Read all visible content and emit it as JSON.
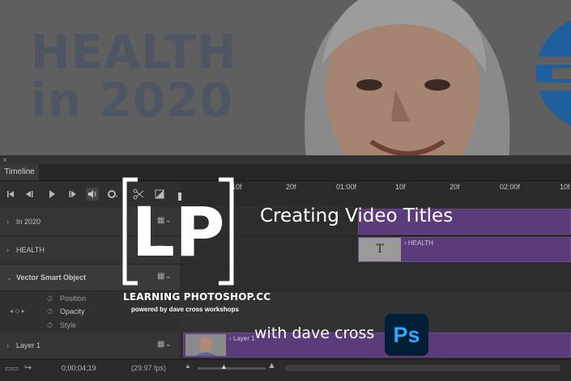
{
  "preview": {
    "title_lines": [
      "HEALTH",
      "in 2020"
    ]
  },
  "panel": {
    "close_glyph": "×",
    "tab_label": "Timeline"
  },
  "toolbar": {
    "icons": [
      "go-to-first-frame-icon",
      "previous-frame-icon",
      "play-icon",
      "next-frame-icon",
      "audio-icon",
      "settings-icon",
      "split-at-playhead-icon",
      "transition-icon"
    ]
  },
  "ruler": {
    "ticks": [
      "10f",
      "20f",
      "01:00f",
      "10f",
      "20f",
      "02:00f",
      "10f"
    ]
  },
  "tracks": [
    {
      "label": "In 2020"
    },
    {
      "label": "HEALTH",
      "clip_label": "HEALTH",
      "clip_thumb": "T"
    },
    {
      "label": "Vector Smart Object",
      "properties": [
        "Position",
        "Opacity",
        "Style"
      ]
    },
    {
      "label": "Layer 1",
      "clip_label": "Layer 1"
    }
  ],
  "status": {
    "timecode": "0;00;04;19",
    "fps": "(29.97 fps)"
  },
  "branding": {
    "logo_letters": "LP",
    "name": "LEARNING PHOTOSHOP.CC",
    "tagline": "powered by dave cross workshops",
    "headline": "Creating Video Titles",
    "byline": "with dave cross",
    "app_badge": "Ps"
  },
  "colors": {
    "clip_purple": "#5c3b7b",
    "ps_badge_bg": "#001e36",
    "ps_badge_text": "#31a8ff"
  }
}
